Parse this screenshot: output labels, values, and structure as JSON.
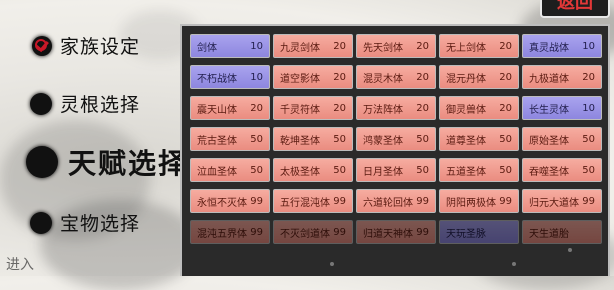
{
  "return_label": "返回",
  "menu": [
    {
      "label": "家族设定",
      "checked": true
    },
    {
      "label": "灵根选择",
      "checked": false
    },
    {
      "label": "天赋选择",
      "active": true
    },
    {
      "label": "宝物选择",
      "checked": false
    }
  ],
  "corner_text": "进入",
  "talents": [
    {
      "name": "剑体",
      "cost": "10",
      "style": "purple"
    },
    {
      "name": "九灵剑体",
      "cost": "20",
      "style": "red"
    },
    {
      "name": "先天剑体",
      "cost": "20",
      "style": "red"
    },
    {
      "name": "无上剑体",
      "cost": "20",
      "style": "red"
    },
    {
      "name": "真灵战体",
      "cost": "10",
      "style": "purple"
    },
    {
      "name": "不朽战体",
      "cost": "10",
      "style": "purple"
    },
    {
      "name": "道空影体",
      "cost": "20",
      "style": "red"
    },
    {
      "name": "混灵木体",
      "cost": "20",
      "style": "red"
    },
    {
      "name": "混元丹体",
      "cost": "20",
      "style": "red"
    },
    {
      "name": "九极道体",
      "cost": "20",
      "style": "red"
    },
    {
      "name": "震天山体",
      "cost": "20",
      "style": "red"
    },
    {
      "name": "千灵符体",
      "cost": "20",
      "style": "red"
    },
    {
      "name": "万法阵体",
      "cost": "20",
      "style": "red"
    },
    {
      "name": "御灵兽体",
      "cost": "20",
      "style": "red"
    },
    {
      "name": "长生灵体",
      "cost": "10",
      "style": "purple"
    },
    {
      "name": "荒古圣体",
      "cost": "50",
      "style": "red"
    },
    {
      "name": "乾坤圣体",
      "cost": "50",
      "style": "red"
    },
    {
      "name": "鸿蒙圣体",
      "cost": "50",
      "style": "red"
    },
    {
      "name": "道尊圣体",
      "cost": "50",
      "style": "red"
    },
    {
      "name": "原始圣体",
      "cost": "50",
      "style": "red"
    },
    {
      "name": "泣血圣体",
      "cost": "50",
      "style": "red"
    },
    {
      "name": "太极圣体",
      "cost": "50",
      "style": "red"
    },
    {
      "name": "日月圣体",
      "cost": "50",
      "style": "red"
    },
    {
      "name": "五道圣体",
      "cost": "50",
      "style": "red"
    },
    {
      "name": "吞噬圣体",
      "cost": "50",
      "style": "red"
    },
    {
      "name": "永恒不灭体",
      "cost": "99",
      "style": "red"
    },
    {
      "name": "五行混沌体",
      "cost": "99",
      "style": "red"
    },
    {
      "name": "六道轮回体",
      "cost": "99",
      "style": "red"
    },
    {
      "name": "阴阳两极体",
      "cost": "99",
      "style": "red"
    },
    {
      "name": "归元大道体",
      "cost": "99",
      "style": "red"
    },
    {
      "name": "混沌五界体",
      "cost": "99",
      "style": "red"
    },
    {
      "name": "不灭剑道体",
      "cost": "99",
      "style": "red"
    },
    {
      "name": "归道天神体",
      "cost": "99",
      "style": "red"
    },
    {
      "name": "天玩圣脉",
      "cost": "",
      "style": "purple"
    },
    {
      "name": "天生道胎",
      "cost": "",
      "style": "red"
    }
  ]
}
